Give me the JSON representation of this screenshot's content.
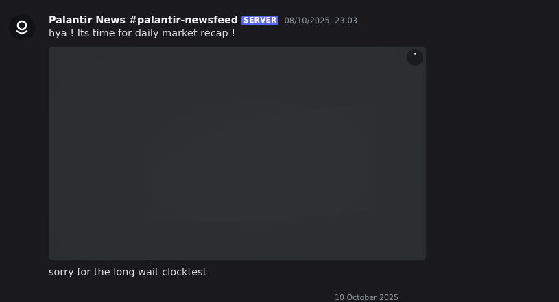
{
  "message": {
    "author": "Palantir News #palantir-newsfeed",
    "badge": "SERVER",
    "timestamp": "08/10/2025, 23:03",
    "text_first": "hya ! Its time for daily market recap !",
    "text_second": "sorry for the long wait clocktest",
    "avatar_icon": "palantir-logo-icon",
    "embed_button_icon": "more-icon"
  },
  "date_divider": "10 October 2025",
  "colors": {
    "background": "#1a1a1e",
    "badge": "#5865f2",
    "embed": "#2c2f32",
    "timestamp": "#949ba4"
  }
}
